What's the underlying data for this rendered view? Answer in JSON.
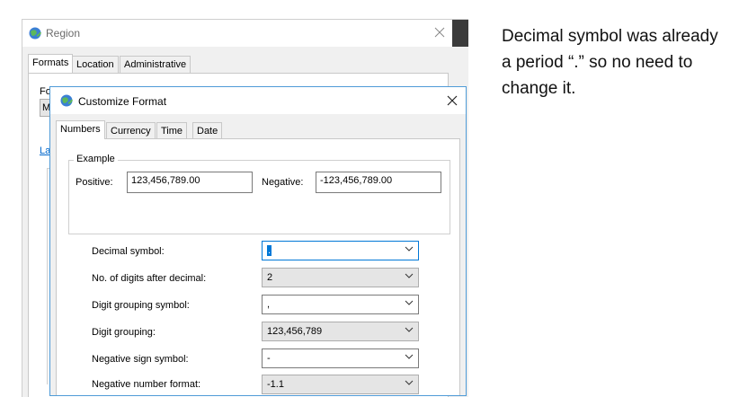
{
  "region_window": {
    "title": "Region",
    "tabs": [
      "Formats",
      "Location",
      "Administrative"
    ],
    "partial_left_labels": [
      "Fo",
      "M",
      "La"
    ]
  },
  "dialog": {
    "title": "Customize Format",
    "tabs": [
      "Numbers",
      "Currency",
      "Time",
      "Date"
    ],
    "example": {
      "legend": "Example",
      "positive_label": "Positive:",
      "positive_value": "123,456,789.00",
      "negative_label": "Negative:",
      "negative_value": "-123,456,789.00"
    },
    "settings": [
      {
        "label": "Decimal symbol:",
        "value": "."
      },
      {
        "label": "No. of digits after decimal:",
        "value": "2"
      },
      {
        "label": "Digit grouping symbol:",
        "value": ","
      },
      {
        "label": "Digit grouping:",
        "value": "123,456,789"
      },
      {
        "label": "Negative sign symbol:",
        "value": "-"
      },
      {
        "label": "Negative number format:",
        "value": "-1.1"
      }
    ]
  },
  "annotation": {
    "text": "Decimal symbol was already a period “.” so no need to change it."
  },
  "colors": {
    "dialog_border": "#4f9bd7",
    "focus_border": "#0078d7",
    "window_bg": "#f0f0f0"
  }
}
